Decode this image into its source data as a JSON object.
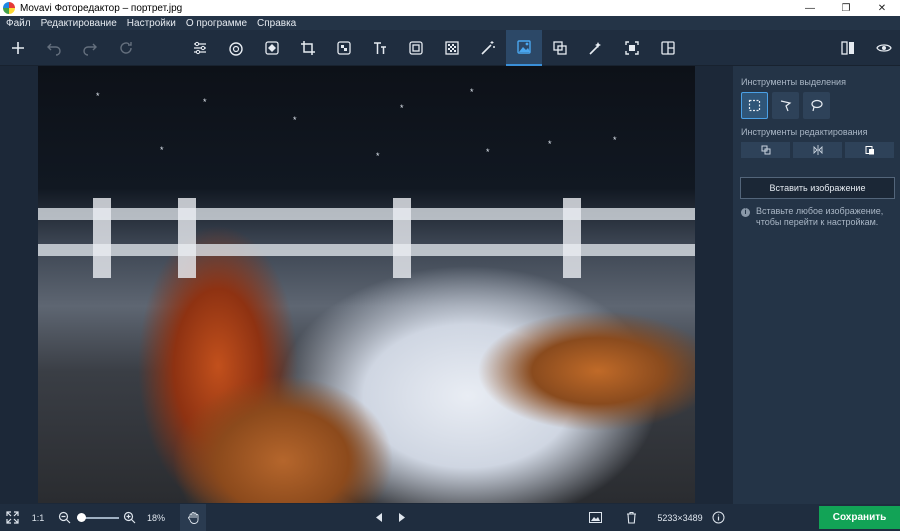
{
  "window": {
    "title": "Movavi Фоторедактор – портрет.jpg",
    "controls": [
      "minimize",
      "restore",
      "close"
    ]
  },
  "menu": {
    "items": [
      "Файл",
      "Редактирование",
      "Настройки",
      "О программе",
      "Справка"
    ]
  },
  "toolbar": {
    "left_icons": [
      "add-icon",
      "undo-icon",
      "redo-icon",
      "reset-icon"
    ],
    "tools": [
      "adjust-icon",
      "retouch-icon",
      "object-removal-icon",
      "crop-icon",
      "effects-icon",
      "text-icon",
      "frames-icon",
      "noise-icon",
      "magic-wand-icon",
      "replace-background-icon",
      "selection-icon",
      "enhance-icon",
      "transform-icon",
      "layout-icon"
    ],
    "active_tool": "replace-background-icon",
    "right_icons": [
      "compare-icon",
      "preview-icon"
    ]
  },
  "panel": {
    "selection_tools_label": "Инструменты выделения",
    "selection_tools": [
      "rect-select-icon",
      "polygon-lasso-icon",
      "lasso-icon"
    ],
    "editing_tools_label": "Инструменты редактирования",
    "editing_tools": [
      "clone-icon",
      "flip-icon",
      "paste-icon"
    ],
    "insert_button": "Вставить изображение",
    "info_text": "Вставьте любое изображение, чтобы перейти к настройкам."
  },
  "bottom": {
    "actual_size": "1:1",
    "zoom_percent": "18%",
    "zoom_level": 0.18,
    "dimensions": "5233×3489",
    "save": "Сохранить"
  },
  "colors": {
    "accent": "#3a8fd8",
    "save": "#12a356",
    "panel": "#243447"
  }
}
